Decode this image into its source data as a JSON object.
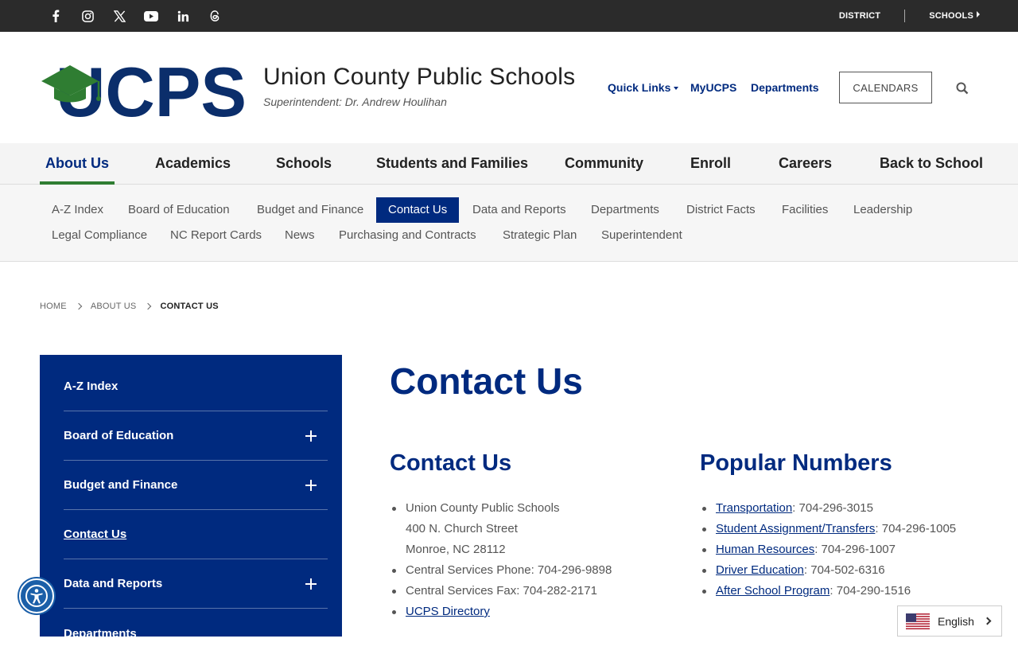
{
  "topbar": {
    "social_icons": [
      "facebook-icon",
      "instagram-icon",
      "x-icon",
      "youtube-icon",
      "linkedin-icon",
      "threads-icon"
    ],
    "district": "DISTRICT",
    "schools": "SCHOOLS"
  },
  "header": {
    "logo_text": "UCPS",
    "title": "Union County Public Schools",
    "subtitle": "Superintendent: Dr. Andrew Houlihan",
    "quick_links": "Quick Links",
    "myucps": "MyUCPS",
    "departments": "Departments",
    "calendars": "CALENDARS"
  },
  "main_nav": [
    "About Us",
    "Academics",
    "Schools",
    "Students and Families",
    "Community",
    "Enroll",
    "Careers",
    "Back to School"
  ],
  "sub_nav": {
    "row1": [
      "A-Z Index",
      "Board of Education",
      "Budget and Finance",
      "Contact Us",
      "Data and Reports",
      "Departments",
      "District Facts",
      "Facilities",
      "Leadership"
    ],
    "row2": [
      "Legal Compliance",
      "NC Report Cards",
      "News",
      "Purchasing and Contracts",
      "Strategic Plan",
      "Superintendent"
    ]
  },
  "breadcrumb": {
    "home": "HOME",
    "about": "ABOUT US",
    "current": "CONTACT US"
  },
  "sidebar": [
    "A-Z Index",
    "Board of Education",
    "Budget and Finance",
    "Contact Us",
    "Data and Reports",
    "Departments"
  ],
  "content": {
    "title": "Contact Us",
    "contact": {
      "heading": "Contact Us",
      "address1": "Union County Public Schools",
      "address2": "400 N. Church Street",
      "address3": "Monroe, NC 28112",
      "phone": "Central Services Phone: 704-296-9898",
      "fax": "Central Services Fax: 704-282-2171",
      "directory": "UCPS Directory"
    },
    "popular": {
      "heading": "Popular Numbers",
      "items": [
        {
          "label": "Transportation",
          "number": ": 704-296-3015"
        },
        {
          "label": "Student Assignment/Transfers",
          "number": ": 704-296-1005"
        },
        {
          "label": "Human Resources",
          "number": ": 704-296-1007"
        },
        {
          "label": "Driver Education",
          "number": ": 704-502-6316"
        },
        {
          "label": "After School Program",
          "number": ": 704-290-1516"
        }
      ]
    }
  },
  "language": "English",
  "colors": {
    "brand": "#002a7f",
    "accent_green": "#2f7d32",
    "topbar": "#2b2b2b"
  }
}
